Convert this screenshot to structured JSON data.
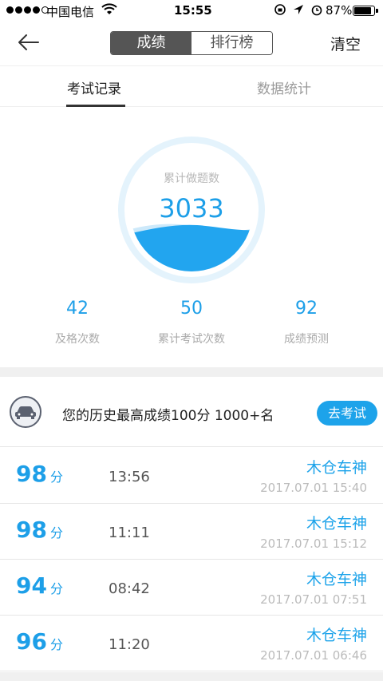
{
  "status_bar": {
    "carrier": "中国电信",
    "time": "15:55",
    "battery_percent": "87%",
    "battery_level": 0.87
  },
  "nav": {
    "segments": [
      "成绩",
      "排行榜"
    ],
    "active_segment": "成绩",
    "clear_label": "清空"
  },
  "tabs": [
    {
      "label": "考试记录",
      "active": true
    },
    {
      "label": "数据统计",
      "active": false
    }
  ],
  "summary": {
    "total_label": "累计做题数",
    "total_value": "3033",
    "stats": [
      {
        "value": "42",
        "label": "及格次数"
      },
      {
        "value": "50",
        "label": "累计考试次数"
      },
      {
        "value": "92",
        "label": "成绩预测"
      }
    ]
  },
  "best": {
    "text": "您的历史最高成绩100分 1000+名",
    "button_label": "去考试"
  },
  "records": [
    {
      "score": "98",
      "unit": "分",
      "duration": "13:56",
      "user": "木仓车神",
      "datetime": "2017.07.01 15:40"
    },
    {
      "score": "98",
      "unit": "分",
      "duration": "11:11",
      "user": "木仓车神",
      "datetime": "2017.07.01 15:12"
    },
    {
      "score": "94",
      "unit": "分",
      "duration": "08:42",
      "user": "木仓车神",
      "datetime": "2017.07.01 07:51"
    },
    {
      "score": "96",
      "unit": "分",
      "duration": "11:20",
      "user": "木仓车神",
      "datetime": "2017.07.01 06:46"
    }
  ],
  "colors": {
    "accent": "#1d9fe8",
    "segment_active": "#555555"
  }
}
